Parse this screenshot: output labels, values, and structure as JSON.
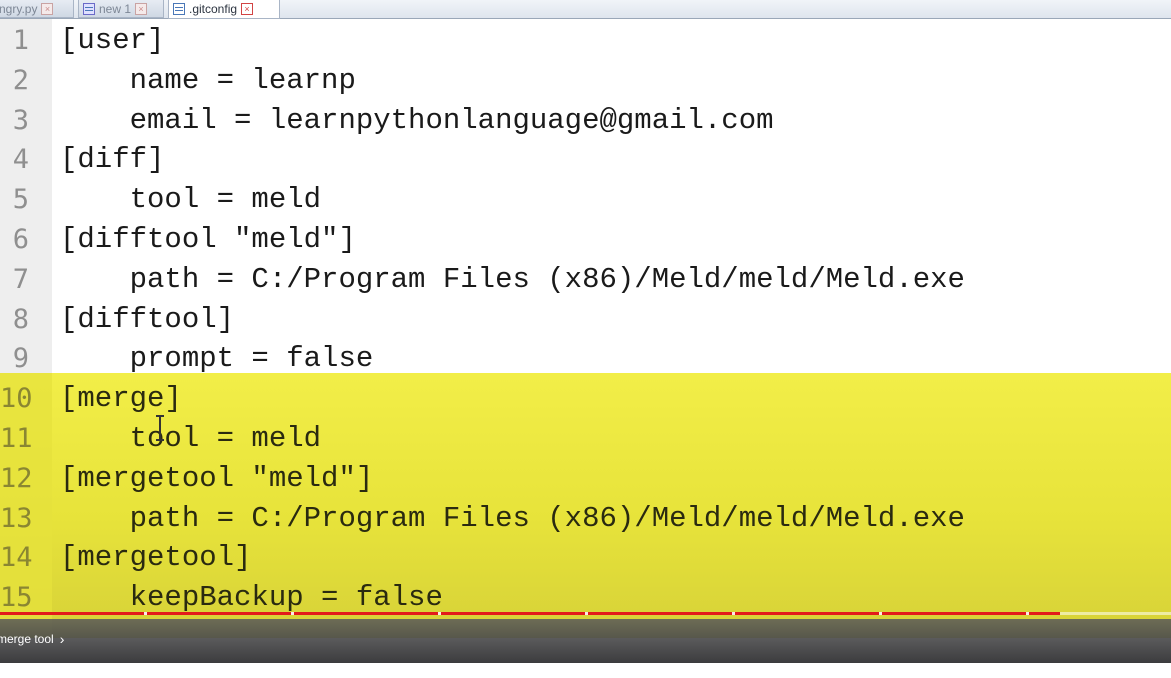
{
  "tabs": [
    {
      "label": "ngry.py",
      "icon": "saved-file-icon",
      "close": "×",
      "active": false
    },
    {
      "label": "new 1",
      "icon": "modified-file-icon",
      "close": "×",
      "active": false
    },
    {
      "label": ".gitconfig",
      "icon": "saved-file-icon",
      "close": "×",
      "active": true
    }
  ],
  "editor": {
    "lines": [
      {
        "num": "1",
        "text": "[user]"
      },
      {
        "num": "2",
        "text": "    name = learnp"
      },
      {
        "num": "3",
        "text": "    email = learnpythonlanguage@gmail.com"
      },
      {
        "num": "4",
        "text": "[diff]"
      },
      {
        "num": "5",
        "text": "    tool = meld"
      },
      {
        "num": "6",
        "text": "[difftool \"meld\"]"
      },
      {
        "num": "7",
        "text": "    path = C:/Program Files (x86)/Meld/meld/Meld.exe"
      },
      {
        "num": "8",
        "text": "[difftool]"
      },
      {
        "num": "9",
        "text": "    prompt = false"
      },
      {
        "num": "10",
        "text": "[merge]"
      },
      {
        "num": "11",
        "text": "    tool = meld"
      },
      {
        "num": "12",
        "text": "[mergetool \"meld\"]"
      },
      {
        "num": "13",
        "text": "    path = C:/Program Files (x86)/Meld/meld/Meld.exe"
      },
      {
        "num": "14",
        "text": "[mergetool]"
      },
      {
        "num": "15",
        "text": "    keepBackup = false"
      }
    ],
    "highlight_from_line": 10,
    "highlight_color": "#eeea42"
  },
  "player": {
    "chapter_label": "merge tool",
    "chapter_chevron": "›",
    "progress_fraction": 0.905,
    "progress_color": "#e31b1b"
  }
}
